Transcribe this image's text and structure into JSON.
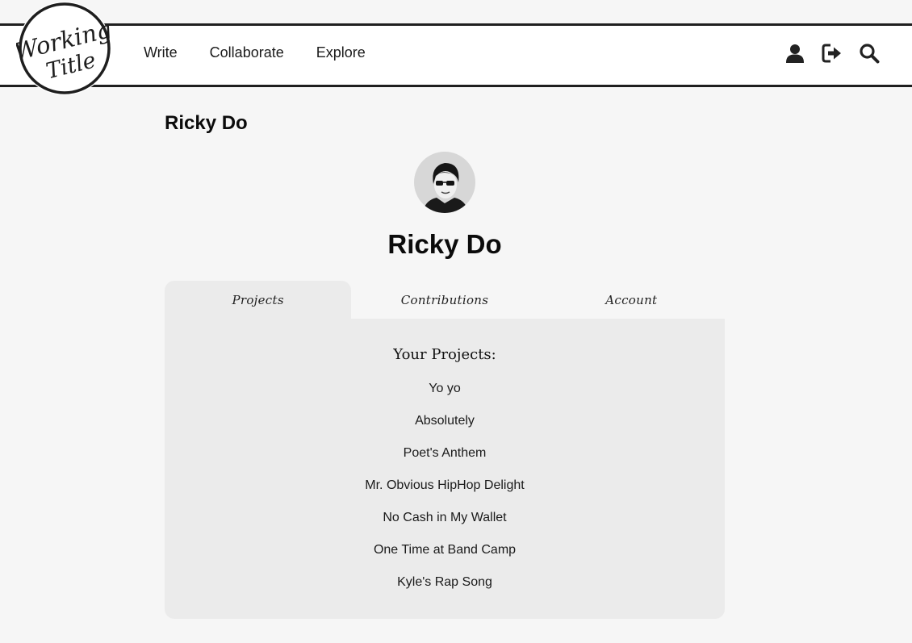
{
  "logo": {
    "line1": "Working",
    "line2": "Title"
  },
  "nav": {
    "links": [
      "Write",
      "Collaborate",
      "Explore"
    ],
    "icons": [
      "user-icon",
      "sign-out-icon",
      "search-icon"
    ]
  },
  "page": {
    "heading": "Ricky Do"
  },
  "profile": {
    "name": "Ricky Do"
  },
  "tabs": [
    {
      "label": "Projects",
      "active": true
    },
    {
      "label": "Contributions",
      "active": false
    },
    {
      "label": "Account",
      "active": false
    }
  ],
  "projects": {
    "title": "Your Projects:",
    "items": [
      "Yo yo",
      "Absolutely",
      "Poet's Anthem",
      "Mr. Obvious HipHop Delight",
      "No Cash in My Wallet",
      "One Time at Band Camp",
      "Kyle's Rap Song"
    ]
  }
}
